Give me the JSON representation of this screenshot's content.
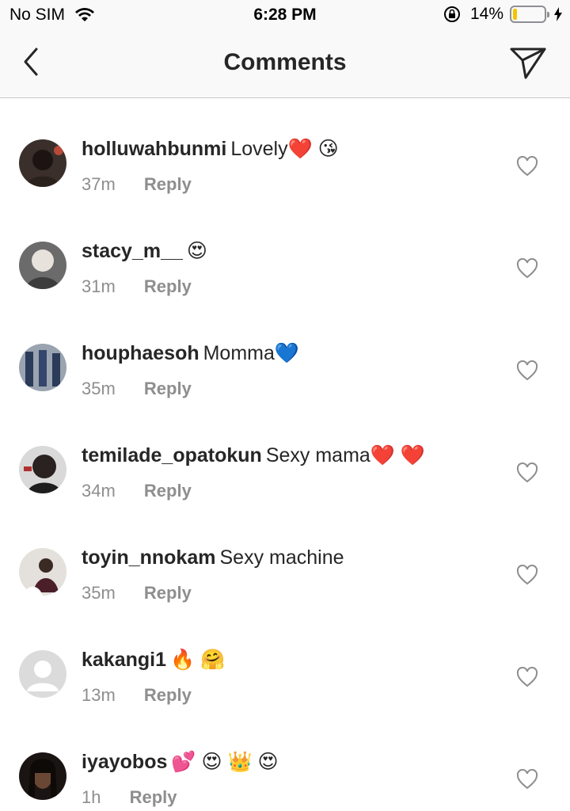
{
  "status_bar": {
    "carrier": "No SIM",
    "time": "6:28 PM",
    "battery_percent": "14%",
    "battery_level": 0.14,
    "icons": [
      "wifi-icon",
      "orientation-lock-icon",
      "battery-icon",
      "charging-bolt-icon"
    ]
  },
  "nav": {
    "title": "Comments",
    "back_icon": "chevron-left-icon",
    "send_icon": "direct-send-icon"
  },
  "colors": {
    "text": "#262626",
    "meta": "#8e8e8e",
    "battery": "#f5c400"
  },
  "comments": [
    {
      "username": "holluwahbunmi",
      "text": "Lovely❤️ 😘",
      "time": "37m",
      "reply": "Reply"
    },
    {
      "username": "stacy_m__",
      "text": "😍",
      "time": "31m",
      "reply": "Reply"
    },
    {
      "username": "houphaesoh",
      "text": "Momma💙",
      "time": "35m",
      "reply": "Reply"
    },
    {
      "username": "temilade_opatokun",
      "text": "Sexy mama❤️ ❤️",
      "time": "34m",
      "reply": "Reply"
    },
    {
      "username": "toyin_nnokam",
      "text": "Sexy machine",
      "time": "35m",
      "reply": "Reply"
    },
    {
      "username": "kakangi1",
      "text": "🔥 🤗",
      "time": "13m",
      "reply": "Reply"
    },
    {
      "username": "iyayobos",
      "text": "💕 😍 👑 😍",
      "time": "1h",
      "reply": "Reply"
    }
  ]
}
